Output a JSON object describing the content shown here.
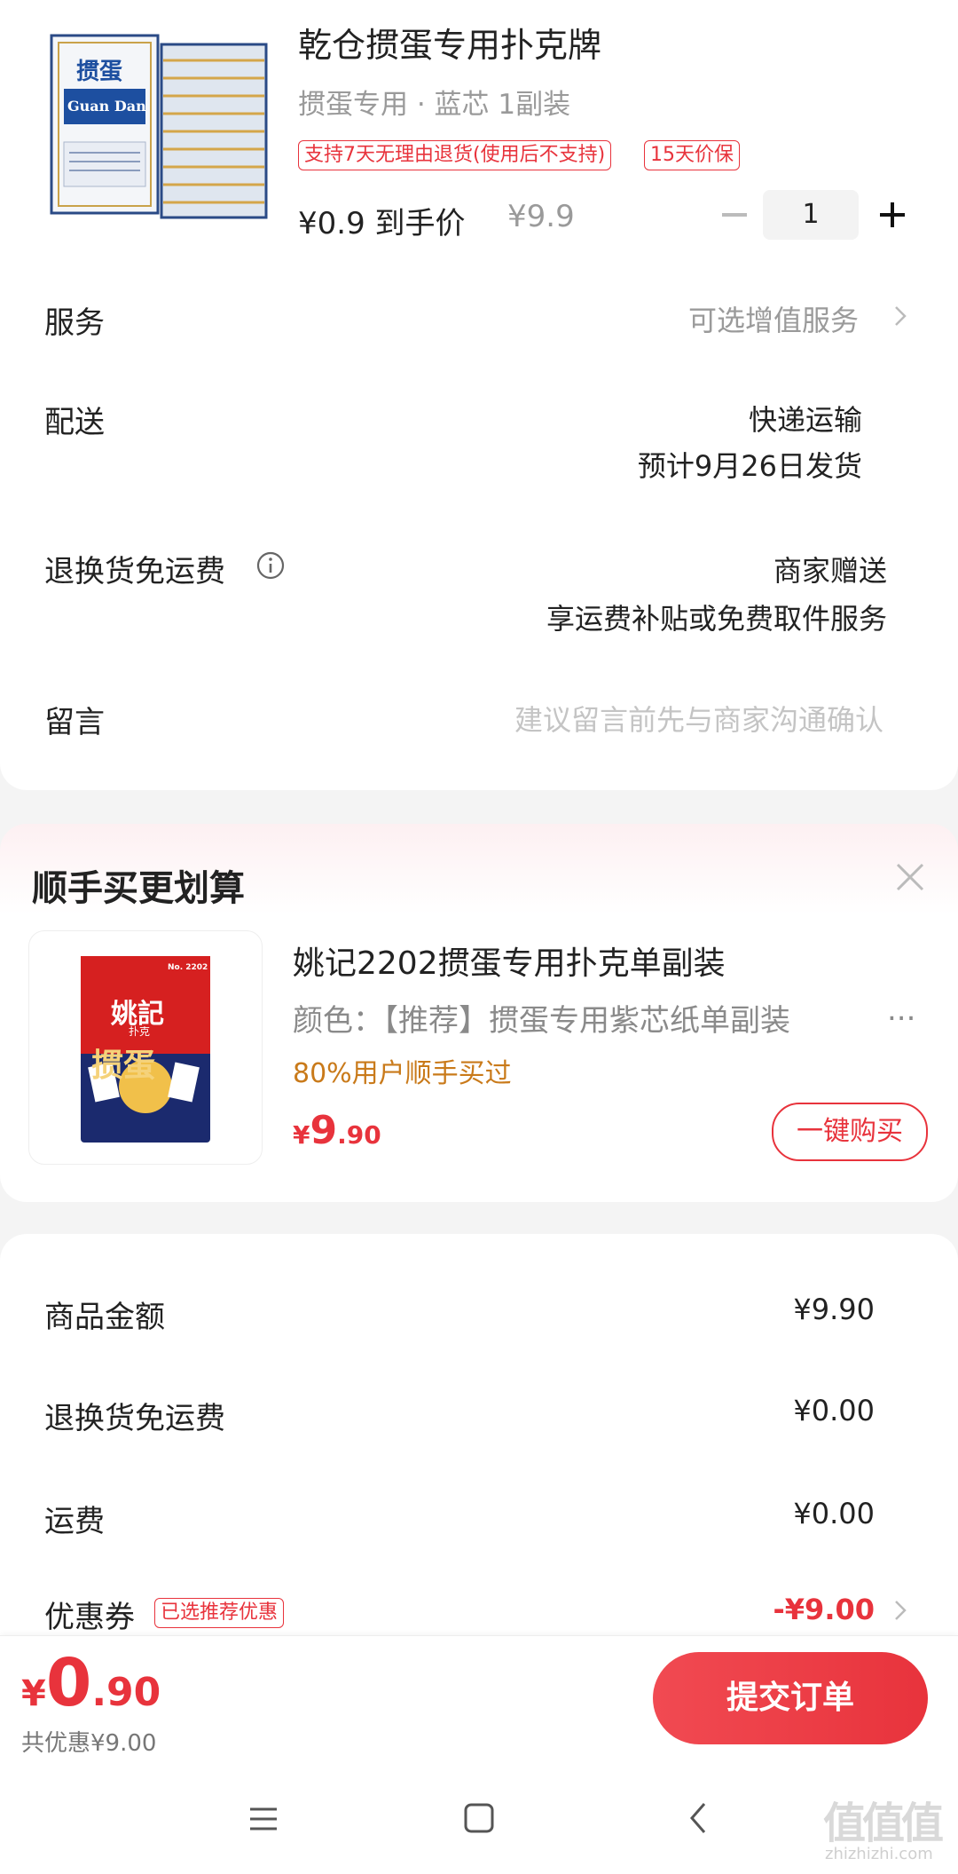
{
  "product": {
    "title": "乾仓掼蛋专用扑克牌",
    "spec": "掼蛋专用 · 蓝芯 1副装",
    "tags": [
      "支持7天无理由退货(使用后不支持)",
      "15天价保"
    ],
    "final_price": "¥0.9 到手价",
    "orig_price": "¥9.9",
    "quantity": "1",
    "box_brand": "掼蛋",
    "box_subtitle": "Guan Dan"
  },
  "service": {
    "label": "服务",
    "value": "可选增值服务"
  },
  "delivery": {
    "label": "配送",
    "method": "快递运输",
    "eta": "预计9月26日发货"
  },
  "return_fee": {
    "label": "退换货免运费",
    "line1": "商家赠送",
    "line2": "享运费补贴或免费取件服务"
  },
  "message": {
    "label": "留言",
    "placeholder": "建议留言前先与商家沟通确认"
  },
  "upsell": {
    "title": "顺手买更划算",
    "name": "姚记2202掼蛋专用扑克单副装",
    "spec": "颜色：【推荐】掼蛋专用紫芯纸单副装",
    "ellipsis": "...",
    "social": "80%用户顺手买过",
    "price_symbol": "¥",
    "price_int": "9",
    "price_dec": ".90",
    "buy_label": "一键购买",
    "pack_brand": "姚記",
    "pack_sub": "扑克",
    "pack_big": "掼蛋",
    "pack_no": "No. 2202"
  },
  "summary": {
    "rows": [
      {
        "label": "商品金额",
        "value": "¥9.90"
      },
      {
        "label": "退换货免运费",
        "value": "¥0.00"
      },
      {
        "label": "运费",
        "value": "¥0.00"
      }
    ],
    "coupon_label": "优惠券",
    "coupon_tag": "已选推荐优惠",
    "coupon_value": "-¥9.00"
  },
  "footer": {
    "total_symbol": "¥",
    "total_int": "0",
    "total_dec": ".90",
    "saved": "共优惠¥9.00",
    "submit": "提交订单"
  },
  "watermark": {
    "text": "值值值",
    "url": "zhizhizhi.com"
  },
  "colors": {
    "accent": "#e8333c",
    "orange": "#c97a1a",
    "grey": "#9a9a9a"
  }
}
